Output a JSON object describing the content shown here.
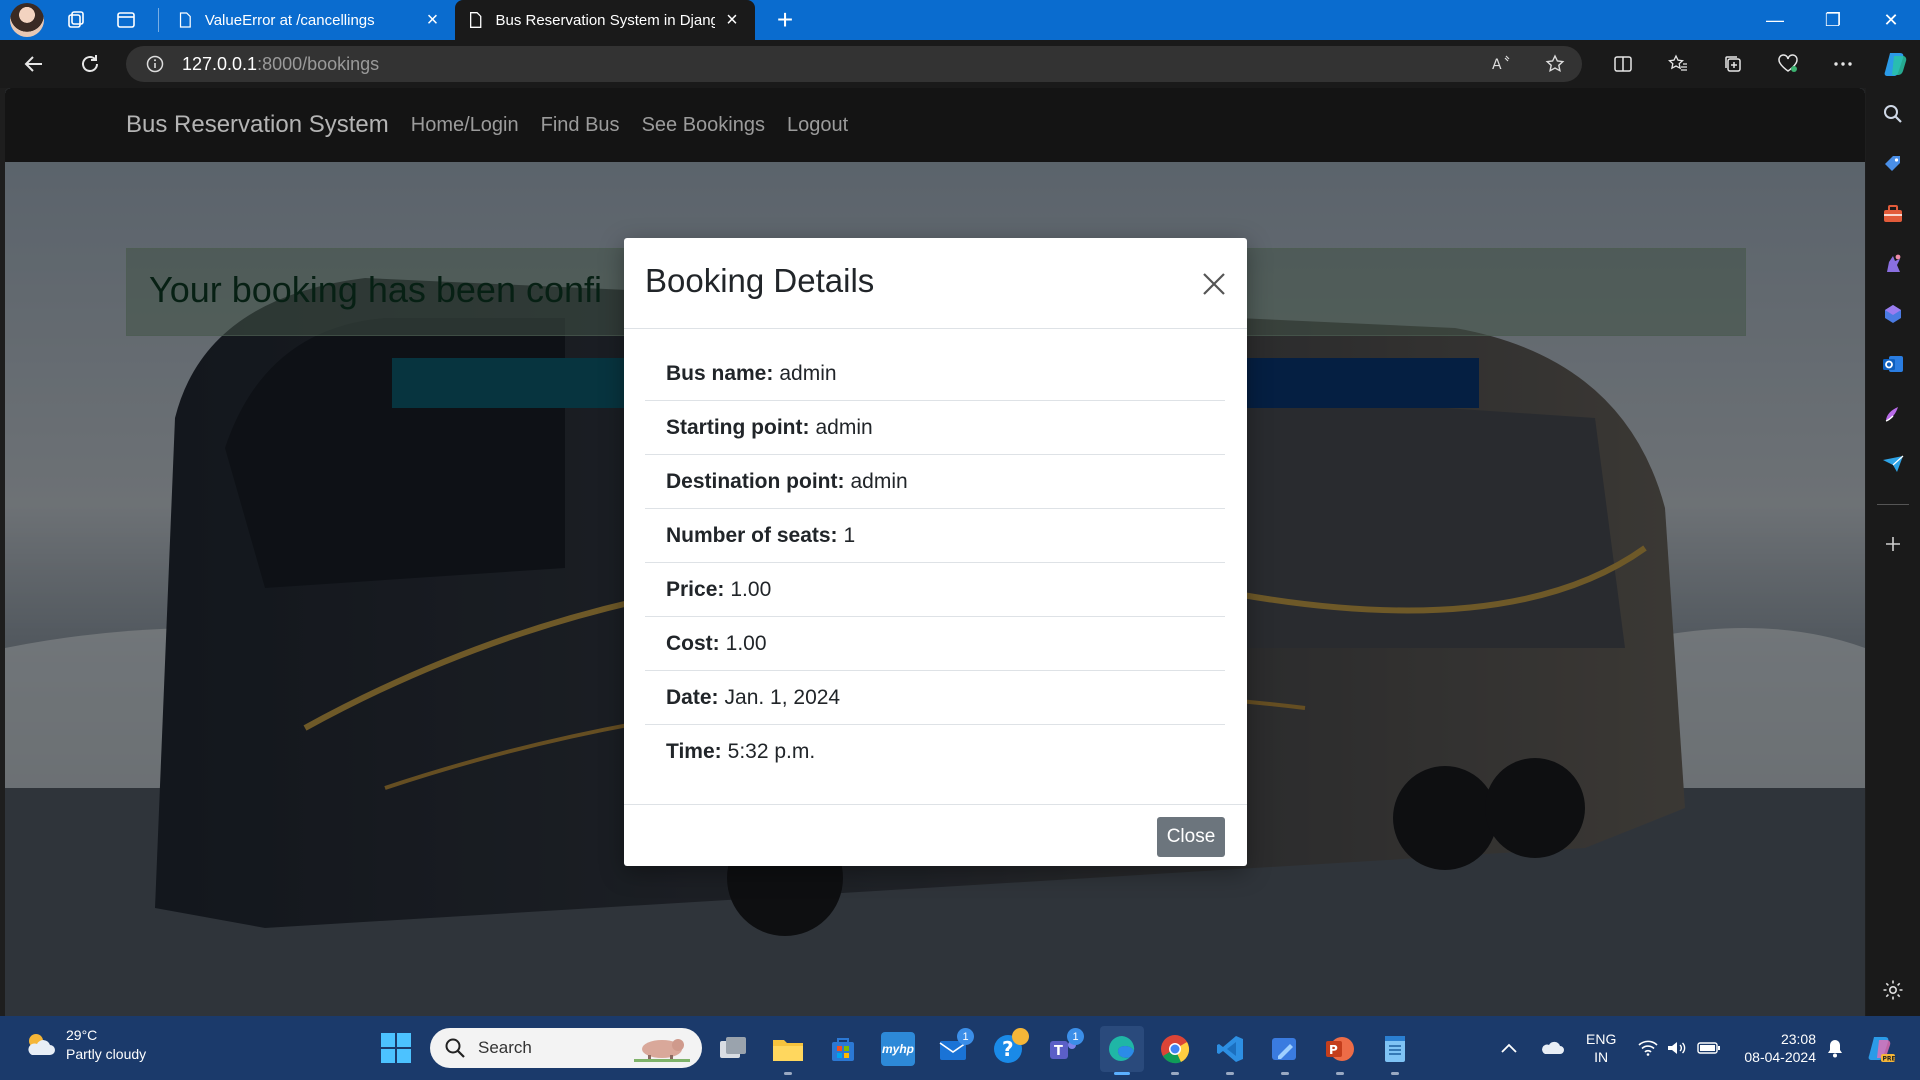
{
  "browser": {
    "tabs": [
      {
        "title": "ValueError at /cancellings",
        "active": false
      },
      {
        "title": "Bus Reservation System in Djang",
        "active": true
      }
    ],
    "url_host": "127.0.0.1",
    "url_rest": ":8000/bookings"
  },
  "site": {
    "brand": "Bus Reservation System",
    "nav": [
      "Home/Login",
      "Find Bus",
      "See Bookings",
      "Logout"
    ],
    "alert_text": "Your booking has been confi"
  },
  "modal": {
    "title": "Booking Details",
    "rows": [
      {
        "label": "Bus name:",
        "value": "admin"
      },
      {
        "label": "Starting point:",
        "value": "admin"
      },
      {
        "label": "Destination point:",
        "value": "admin"
      },
      {
        "label": "Number of seats:",
        "value": "1"
      },
      {
        "label": "Price:",
        "value": "1.00"
      },
      {
        "label": "Cost:",
        "value": "1.00"
      },
      {
        "label": "Date:",
        "value": "Jan. 1, 2024"
      },
      {
        "label": "Time:",
        "value": "5:32 p.m."
      }
    ],
    "close_label": "Close"
  },
  "taskbar": {
    "temperature": "29°C",
    "weather": "Partly cloudy",
    "search_placeholder": "Search",
    "mail_badge": "1",
    "teams_badge": "1",
    "lang_line1": "ENG",
    "lang_line2": "IN",
    "time": "23:08",
    "date": "08-04-2024"
  },
  "colors": {
    "tabstrip": "#0a6ccf",
    "navbar": "#141414",
    "taskbar": "#1b3a6b",
    "close_button": "#6c757d"
  }
}
